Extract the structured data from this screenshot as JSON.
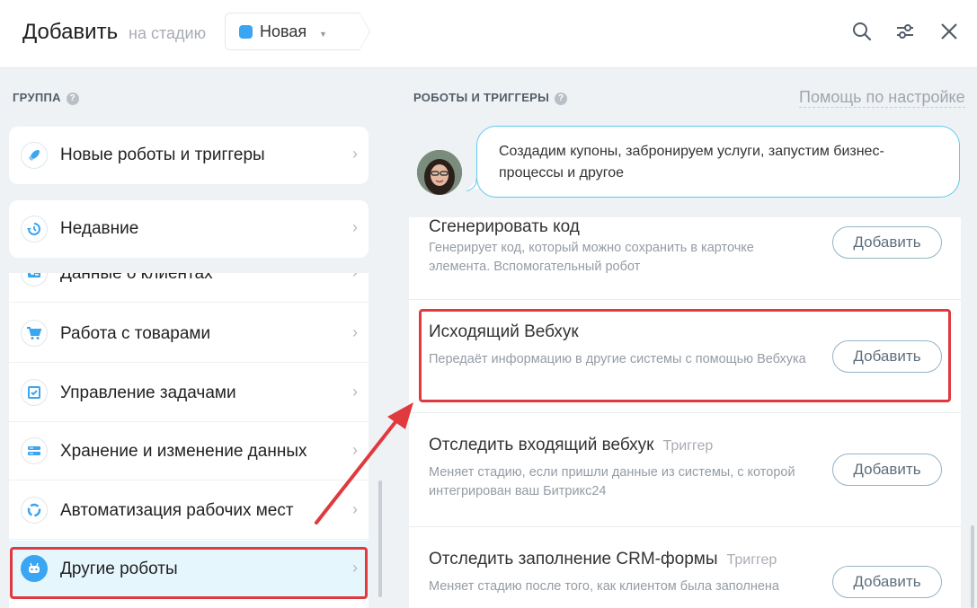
{
  "header": {
    "title": "Добавить",
    "subtitle": "на стадию",
    "stage": {
      "label": "Новая",
      "color": "#3aa5f2"
    },
    "icons": [
      "search-icon",
      "settings-sliders-icon",
      "close-icon"
    ]
  },
  "left": {
    "section_title": "ГРУППА",
    "cards": [
      {
        "label": "Новые роботы и триггеры",
        "icon": "rocket-icon"
      },
      {
        "label": "Недавние",
        "icon": "history-icon"
      }
    ],
    "items": [
      {
        "label": "Данные о клиентах",
        "icon": "contact-card-icon"
      },
      {
        "label": "Работа с товарами",
        "icon": "cart-icon"
      },
      {
        "label": "Управление задачами",
        "icon": "task-check-icon"
      },
      {
        "label": "Хранение и изменение данных",
        "icon": "storage-icon"
      },
      {
        "label": "Автоматизация рабочих мест",
        "icon": "automation-icon"
      },
      {
        "label": "Другие роботы",
        "icon": "robot-icon"
      }
    ]
  },
  "right": {
    "section_title": "РОБОТЫ И ТРИГГЕРЫ",
    "help_link": "Помощь по настройке",
    "bubble": "Создадим купоны, забронируем услуги, запустим бизнес-процессы и другое",
    "robots": [
      {
        "title": "Сгенерировать код",
        "tag": "",
        "desc": "Генерирует код, который можно сохранить в карточке элемента. Вспомогательный робот",
        "button": "Добавить"
      },
      {
        "title": "Исходящий Вебхук",
        "tag": "",
        "desc": "Передаёт информацию в другие системы с помощью Вебхука",
        "button": "Добавить"
      },
      {
        "title": "Отследить входящий вебхук",
        "tag": "Триггер",
        "desc": "Меняет стадию, если пришли данные из системы, с которой интегрирован ваш Битрикс24",
        "button": "Добавить"
      },
      {
        "title": "Отследить заполнение CRM-формы",
        "tag": "Триггер",
        "desc": "Меняет стадию после того, как клиентом была заполнена",
        "button": "Добавить"
      }
    ]
  },
  "colors": {
    "accent": "#3aa5f2",
    "highlight": "#e0393e",
    "selected_bg": "#e6f6fd"
  }
}
